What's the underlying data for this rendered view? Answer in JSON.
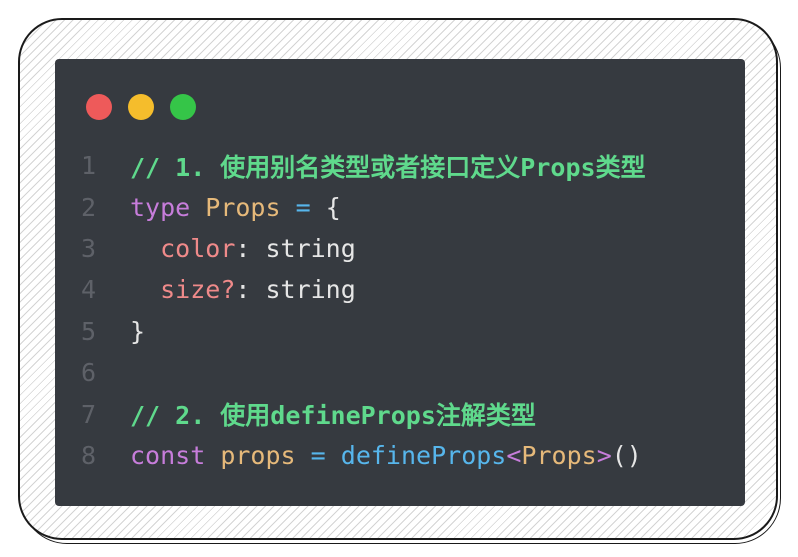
{
  "colors": {
    "window_bg": "#363a40",
    "dot_close": "#ee5a5a",
    "dot_minimize": "#f5bd2c",
    "dot_maximize": "#35c548",
    "comment": "#5fd98c",
    "keyword": "#c77ddb",
    "type": "#e6b97a",
    "operator": "#57b6ec",
    "property": "#ef8a8a",
    "line_number": "#5e6168"
  },
  "window_controls": [
    "close-dot",
    "minimize-dot",
    "maximize-dot"
  ],
  "code": {
    "lines": [
      {
        "num": "1",
        "tokens": [
          {
            "kind": "comment",
            "text": "// 1. 使用别名类型或者接口定义Props类型"
          }
        ]
      },
      {
        "num": "2",
        "tokens": [
          {
            "kind": "keyword",
            "text": "type"
          },
          {
            "kind": "plain",
            "text": " "
          },
          {
            "kind": "type",
            "text": "Props"
          },
          {
            "kind": "plain",
            "text": " "
          },
          {
            "kind": "op",
            "text": "="
          },
          {
            "kind": "plain",
            "text": " {"
          }
        ]
      },
      {
        "num": "3",
        "tokens": [
          {
            "kind": "plain",
            "text": "  "
          },
          {
            "kind": "prop",
            "text": "color"
          },
          {
            "kind": "plain",
            "text": ": string"
          }
        ]
      },
      {
        "num": "4",
        "tokens": [
          {
            "kind": "plain",
            "text": "  "
          },
          {
            "kind": "prop",
            "text": "size?"
          },
          {
            "kind": "plain",
            "text": ": string"
          }
        ]
      },
      {
        "num": "5",
        "tokens": [
          {
            "kind": "plain",
            "text": "}"
          }
        ]
      },
      {
        "num": "6",
        "tokens": []
      },
      {
        "num": "7",
        "tokens": [
          {
            "kind": "comment",
            "text": "// 2. 使用defineProps注解类型"
          }
        ]
      },
      {
        "num": "8",
        "tokens": [
          {
            "kind": "keyword",
            "text": "const"
          },
          {
            "kind": "plain",
            "text": " "
          },
          {
            "kind": "var",
            "text": "props"
          },
          {
            "kind": "plain",
            "text": " "
          },
          {
            "kind": "op",
            "text": "="
          },
          {
            "kind": "plain",
            "text": " "
          },
          {
            "kind": "func",
            "text": "defineProps"
          },
          {
            "kind": "keyword",
            "text": "<"
          },
          {
            "kind": "type",
            "text": "Props"
          },
          {
            "kind": "keyword",
            "text": ">"
          },
          {
            "kind": "plain",
            "text": "()"
          }
        ]
      }
    ]
  }
}
